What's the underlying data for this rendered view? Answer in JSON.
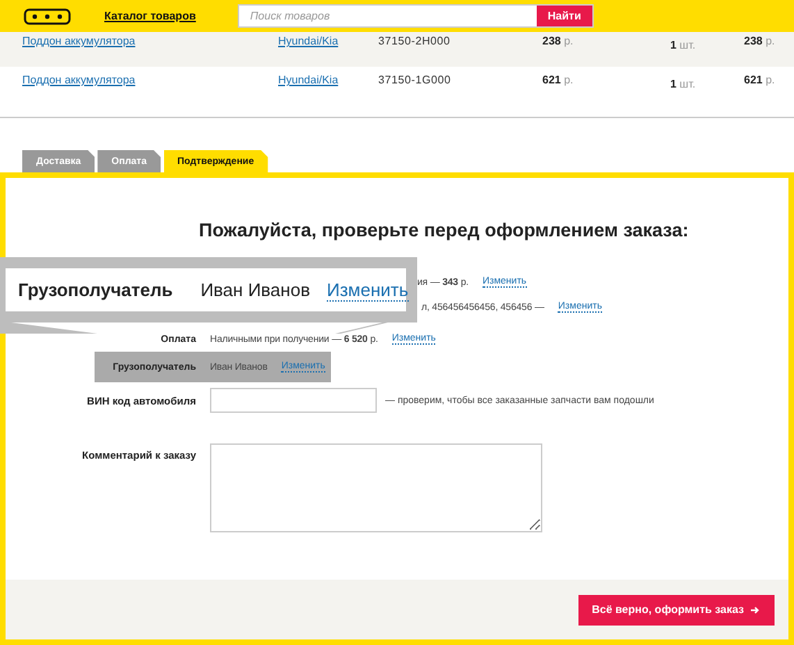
{
  "header": {
    "catalog_link": "Каталог товаров",
    "search": {
      "placeholder": "Поиск товаров",
      "button": "Найти"
    }
  },
  "cart_rows": [
    {
      "name": "Поддон аккумулятора",
      "brand": "Hyundai/Kia",
      "code": "37150-2H000",
      "price": "**238** р.",
      "qty": "**1** шт.",
      "total": "**238** р.",
      "shaded": true
    },
    {
      "name": "Поддон аккумулятора",
      "brand": "Hyundai/Kia",
      "code": "37150-1G000",
      "price": "**621** р.",
      "qty": "**1** шт.",
      "total": "**621** р.",
      "shaded": false
    }
  ],
  "tabs": [
    {
      "label": "Доставка",
      "selected": false
    },
    {
      "label": "Оплата",
      "selected": false
    },
    {
      "label": "Подтверждение",
      "selected": true
    }
  ],
  "title": "Пожалуйста, проверьте перед оформлением заказа:",
  "summary": [
    {
      "kind": "partial",
      "value": "ия — **343** р.",
      "link": "Изменить",
      "highlighted": false
    },
    {
      "kind": "partial",
      "value": "л, 456456456456, 456456 —",
      "link": "Изменить",
      "highlighted": false
    },
    {
      "kind": "full",
      "label": "Оплата",
      "value": "Наличными при получении — **6 520** р.",
      "link": "Изменить",
      "highlighted": false
    },
    {
      "kind": "full",
      "label": "Грузополучатель",
      "value": "Иван Иванов",
      "link": "Изменить",
      "highlighted": true
    }
  ],
  "callout": {
    "label": "Грузополучатель",
    "value": "Иван Иванов",
    "link": "Изменить"
  },
  "vin": {
    "label": "ВИН код автомобиля",
    "hint": "— проверим, чтобы все заказанные запчасти вам подошли"
  },
  "comment": {
    "label": "Комментарий к заказу"
  },
  "submit": "Всё верно, оформить заказ"
}
